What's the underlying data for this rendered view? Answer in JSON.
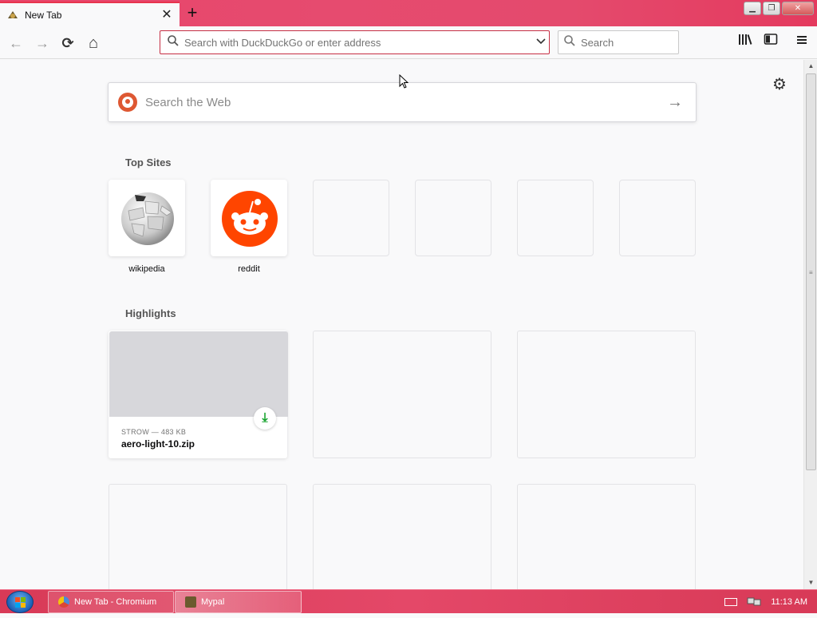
{
  "browser": {
    "tab": {
      "title": "New Tab",
      "close_glyph": "✕"
    },
    "new_tab_glyph": "+",
    "window_buttons": {
      "minimize": "▁",
      "restore": "❐",
      "close": "✕"
    },
    "nav": {
      "back_glyph": "←",
      "forward_glyph": "→",
      "reload_glyph": "⟳",
      "home_glyph": "⌂"
    },
    "urlbar": {
      "placeholder": "Search with DuckDuckGo or enter address",
      "dropdown_glyph": "⌄"
    },
    "searchbar": {
      "placeholder": "Search"
    },
    "toolbar": {
      "library_glyph": "⫼",
      "sidebar_glyph": "◧",
      "menu_glyph": "≡"
    }
  },
  "newtab": {
    "settings_glyph": "⚙",
    "search": {
      "placeholder": "Search the Web",
      "arrow_glyph": "→"
    },
    "top_sites": {
      "title": "Top Sites",
      "items": [
        {
          "label": "wikipedia",
          "icon": "wikipedia-globe-icon"
        },
        {
          "label": "reddit",
          "icon": "reddit-alien-icon"
        }
      ]
    },
    "highlights": {
      "title": "Highlights",
      "items": [
        {
          "meta": "STROW — 483 KB",
          "title": "aero-light-10.zip",
          "download_glyph": "⤓"
        }
      ]
    }
  },
  "taskbar": {
    "tasks": [
      {
        "label": "New Tab - Chromium"
      },
      {
        "label": "Mypal"
      }
    ],
    "clock": "11:13 AM"
  },
  "colors": {
    "accent": "#e64b6f",
    "urlbar_border": "#c62f44",
    "reddit": "#ff4500",
    "ddg": "#de5833",
    "download_green": "#12a12a"
  }
}
